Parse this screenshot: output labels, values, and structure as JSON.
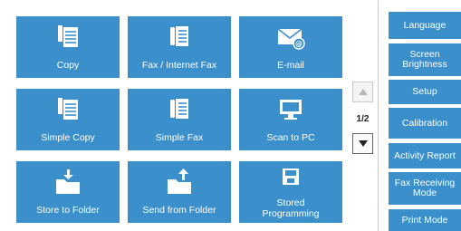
{
  "tiles": [
    {
      "label": "Copy",
      "icon": "copy-icon"
    },
    {
      "label": "Fax / Internet Fax",
      "icon": "fax-icon"
    },
    {
      "label": "E-mail",
      "icon": "email-icon"
    },
    {
      "label": "Simple Copy",
      "icon": "copy-icon"
    },
    {
      "label": "Simple Fax",
      "icon": "fax-icon"
    },
    {
      "label": "Scan to PC",
      "icon": "monitor-icon"
    },
    {
      "label": "Store to Folder",
      "icon": "folder-store-icon"
    },
    {
      "label": "Send from Folder",
      "icon": "folder-send-icon"
    },
    {
      "label": "Stored\nProgramming",
      "icon": "floppy-disk-icon"
    }
  ],
  "pager": {
    "indicator": "1/2"
  },
  "side_menu": [
    {
      "label": "Language"
    },
    {
      "label": "Screen\nBrightness"
    },
    {
      "label": "Setup"
    },
    {
      "label": "Calibration"
    },
    {
      "label": "Activity Report"
    },
    {
      "label": "Fax Receiving\nMode"
    },
    {
      "label": "Print Mode"
    }
  ],
  "colors": {
    "tile": "#3b8fcb",
    "text": "#ffffff"
  }
}
